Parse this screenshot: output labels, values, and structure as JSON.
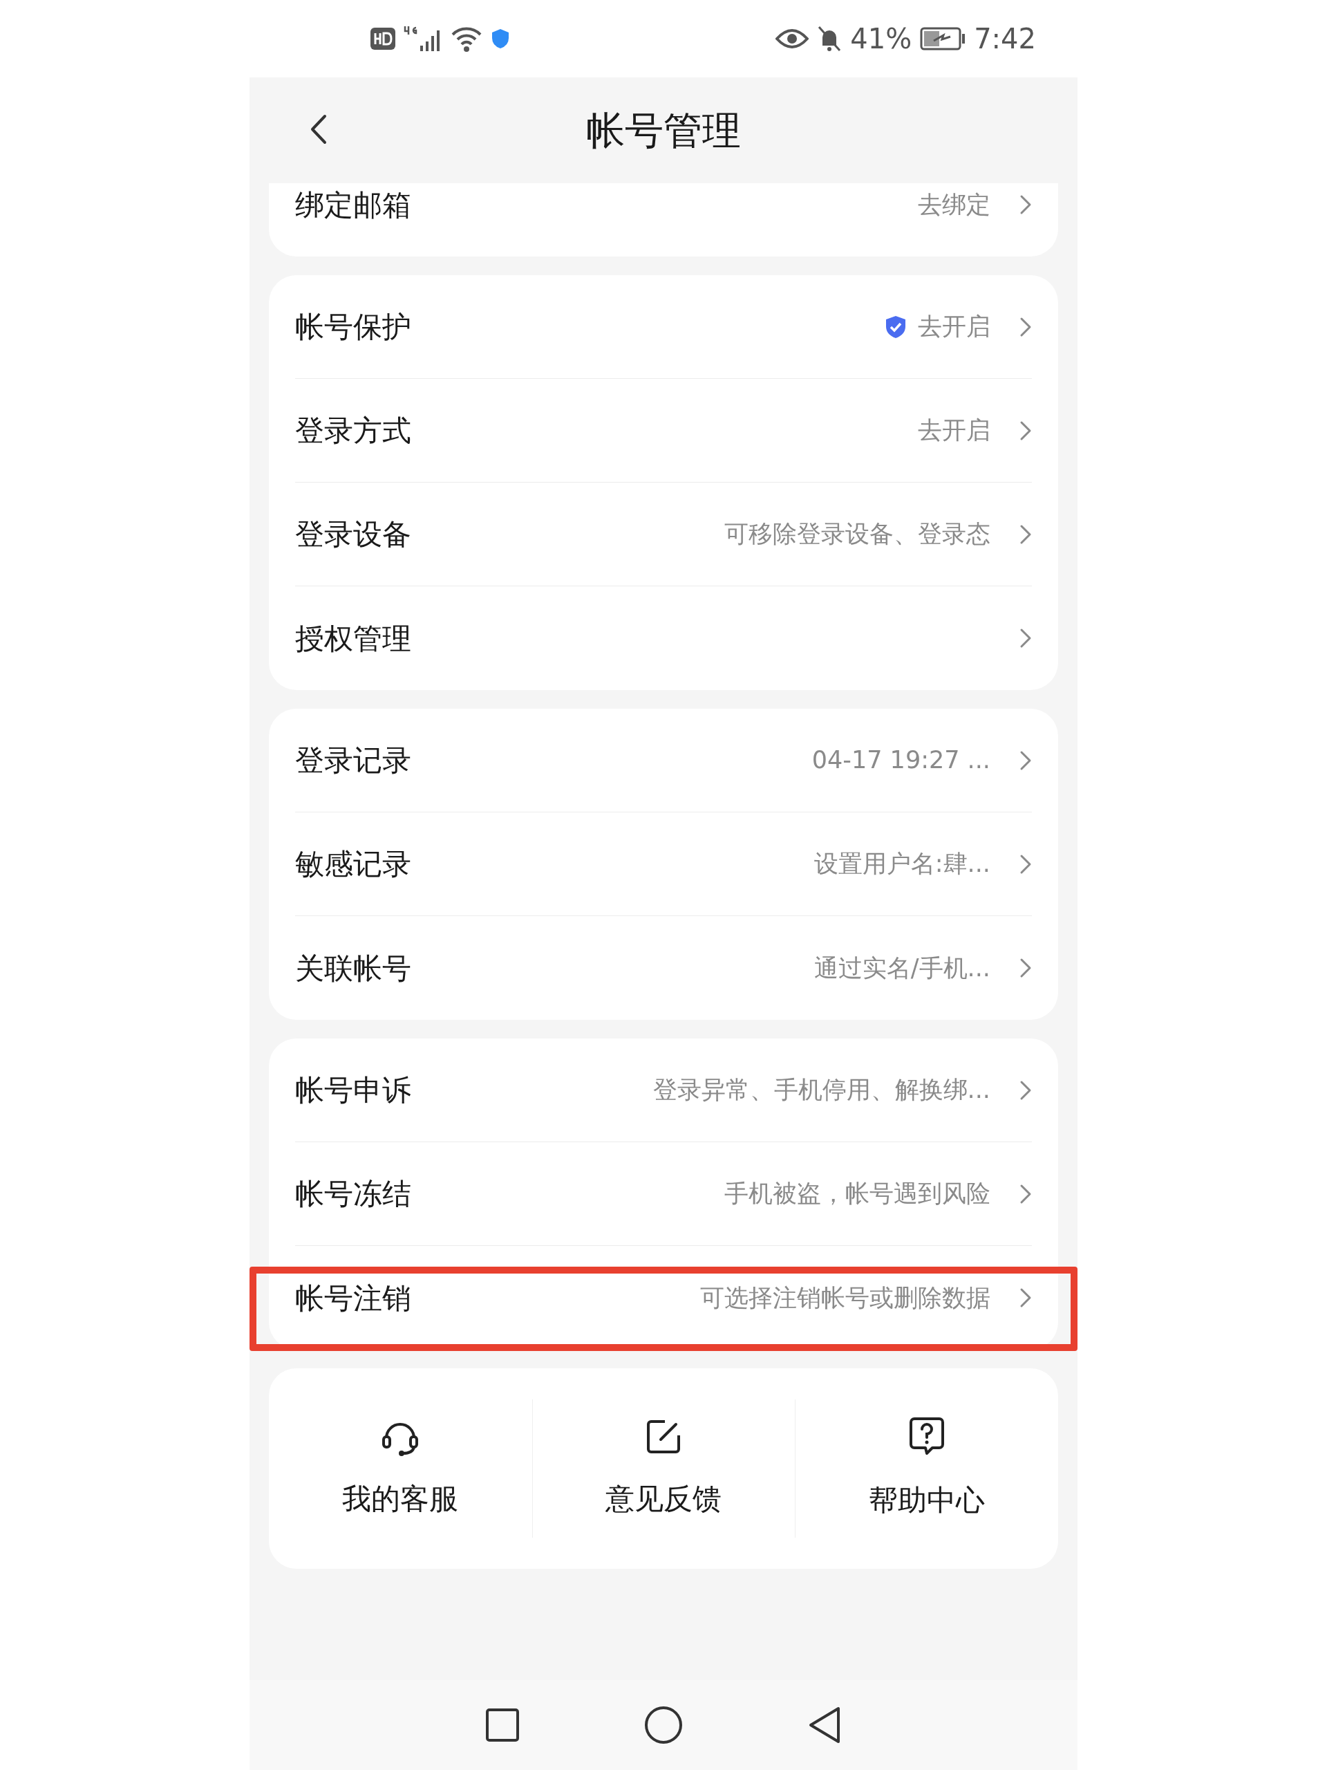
{
  "status_bar": {
    "battery": "41%",
    "time": "7:42"
  },
  "header": {
    "title": "帐号管理"
  },
  "groups": [
    {
      "rows": [
        {
          "label": "绑定邮箱",
          "value": "去绑定",
          "shield": false,
          "highlighted": false
        }
      ]
    },
    {
      "rows": [
        {
          "label": "帐号保护",
          "value": "去开启",
          "shield": true,
          "highlighted": false
        },
        {
          "label": "登录方式",
          "value": "去开启",
          "shield": false,
          "highlighted": false
        },
        {
          "label": "登录设备",
          "value": "可移除登录设备、登录态",
          "shield": false,
          "highlighted": false
        },
        {
          "label": "授权管理",
          "shield": false,
          "highlighted": false
        }
      ]
    },
    {
      "rows": [
        {
          "label": "登录记录",
          "value": "04-17 19:27 ...",
          "shield": false,
          "highlighted": false
        },
        {
          "label": "敏感记录",
          "value": "设置用户名:肆...",
          "shield": false,
          "highlighted": false
        },
        {
          "label": "关联帐号",
          "value": "通过实名/手机...",
          "shield": false,
          "highlighted": false
        }
      ]
    },
    {
      "rows": [
        {
          "label": "帐号申诉",
          "value": "登录异常、手机停用、解换绑...",
          "shield": false,
          "highlighted": false
        },
        {
          "label": "帐号冻结",
          "value": "手机被盗，帐号遇到风险",
          "shield": false,
          "highlighted": false
        },
        {
          "label": "帐号注销",
          "value": "可选择注销帐号或删除数据",
          "shield": false,
          "highlighted": true
        }
      ]
    }
  ],
  "services": [
    {
      "kind": "headset",
      "label": "我的客服"
    },
    {
      "kind": "edit",
      "label": "意见反馈"
    },
    {
      "kind": "help",
      "label": "帮助中心"
    }
  ]
}
